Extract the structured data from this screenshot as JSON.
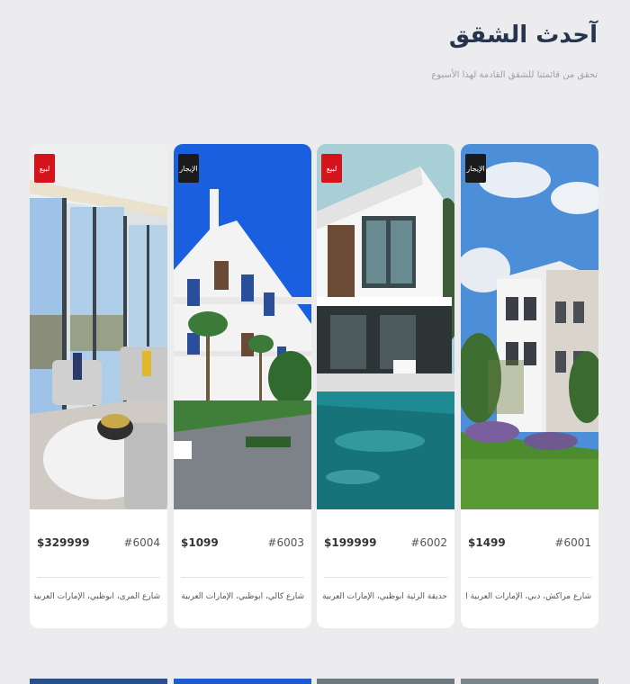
{
  "section": {
    "title": "آحدث الشقق",
    "subtitle": "تحقق من قائمتنا للشقق القادمة لهذا الأسبوع"
  },
  "cards": [
    {
      "id": "#6001",
      "price": "$1499",
      "address": "شارع مراكش، دبي، الإمارات العربية المتحدة",
      "badge": "الإيجار",
      "badge_type": "rent",
      "image_icon": "modern-apartment-garden-photo"
    },
    {
      "id": "#6002",
      "price": "$199999",
      "address": "حديقة الرئية أبوظبي، الإمارات العربية المتحدة",
      "badge": "لبيع",
      "badge_type": "sale",
      "image_icon": "villa-with-pool-photo"
    },
    {
      "id": "#6003",
      "price": "$1099",
      "address": "شارع كالي، أبوظبي، الإمارات العربية المتحدة",
      "badge": "الإيجار",
      "badge_type": "rent",
      "image_icon": "white-building-palms-photo"
    },
    {
      "id": "#6004",
      "price": "$329999",
      "address": "شارع المرى، أبوظبي، الإمارات العربية المتحدة",
      "badge": "لبيع",
      "badge_type": "sale",
      "image_icon": "living-room-interior-photo"
    }
  ],
  "colors": {
    "sale_badge": "#d4141c",
    "rent_badge": "#1b1b1b",
    "title": "#26344e"
  }
}
